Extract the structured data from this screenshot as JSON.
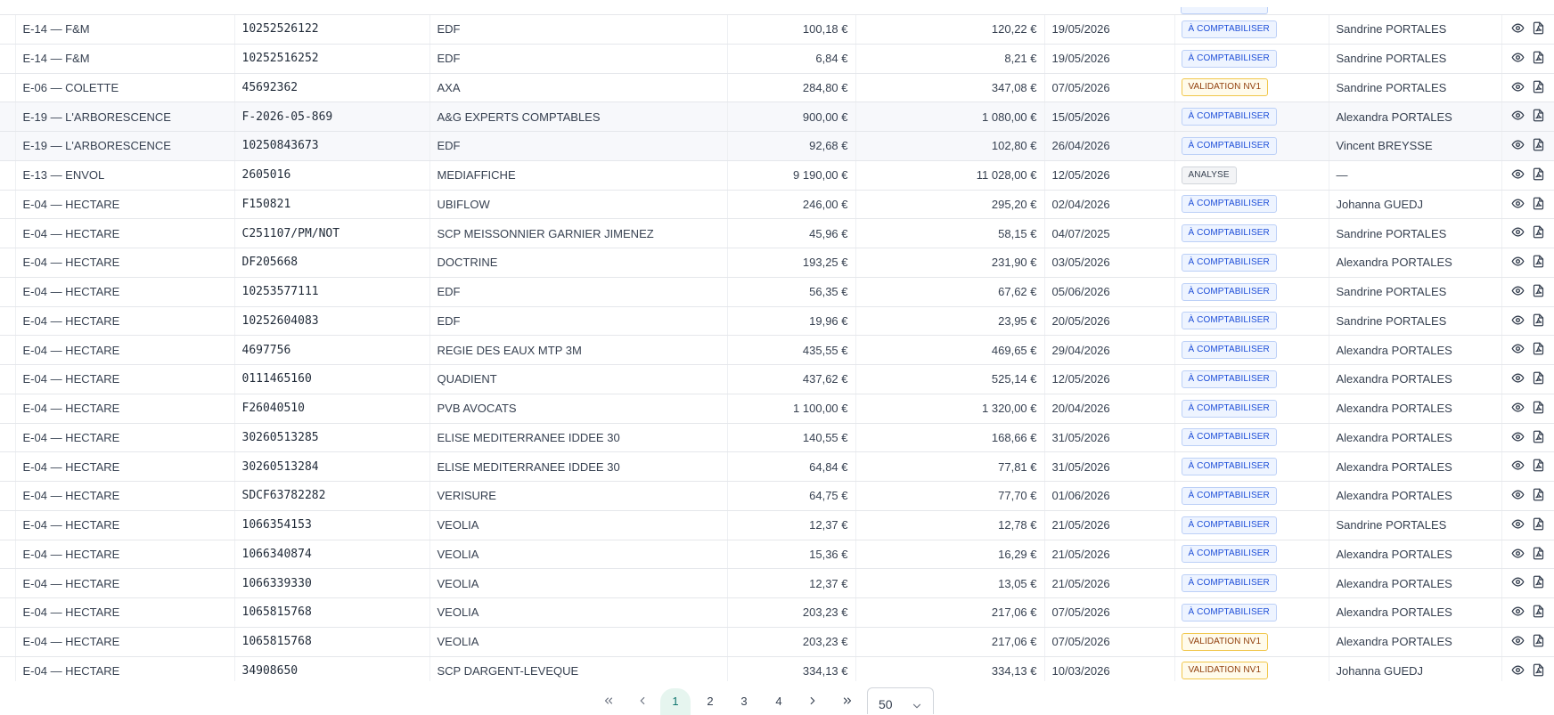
{
  "rows": [
    {
      "client": "E-14 — F&M",
      "ref": "10252526122",
      "supplier": "EDF",
      "ht": "100,18 €",
      "ttc": "120,22 €",
      "date": "19/05/2026",
      "status": "À COMPTABILISER",
      "status_type": "comptabiliser",
      "assignee": "Sandrine PORTALES"
    },
    {
      "client": "E-14 — F&M",
      "ref": "10252516252",
      "supplier": "EDF",
      "ht": "6,84 €",
      "ttc": "8,21 €",
      "date": "19/05/2026",
      "status": "À COMPTABILISER",
      "status_type": "comptabiliser",
      "assignee": "Sandrine PORTALES"
    },
    {
      "client": "E-06 — COLETTE",
      "ref": "45692362",
      "supplier": "AXA",
      "ht": "284,80 €",
      "ttc": "347,08 €",
      "date": "07/05/2026",
      "status": "VALIDATION NV1",
      "status_type": "validation",
      "assignee": "Sandrine PORTALES"
    },
    {
      "client": "E-19 — L'ARBORESCENCE",
      "ref": "F-2026-05-869",
      "supplier": "A&G EXPERTS COMPTABLES",
      "ht": "900,00 €",
      "ttc": "1 080,00 €",
      "date": "15/05/2026",
      "status": "À COMPTABILISER",
      "status_type": "comptabiliser",
      "assignee": "Alexandra PORTALES",
      "alt": true
    },
    {
      "client": "E-19 — L'ARBORESCENCE",
      "ref": "10250843673",
      "supplier": "EDF",
      "ht": "92,68 €",
      "ttc": "102,80 €",
      "date": "26/04/2026",
      "status": "À COMPTABILISER",
      "status_type": "comptabiliser",
      "assignee": "Vincent BREYSSE",
      "alt": true
    },
    {
      "client": "E-13 — ENVOL",
      "ref": "2605016",
      "supplier": "MEDIAFFICHE",
      "ht": "9 190,00 €",
      "ttc": "11 028,00 €",
      "date": "12/05/2026",
      "status": "ANALYSE",
      "status_type": "analyse",
      "assignee": "—"
    },
    {
      "client": "E-04 — HECTARE",
      "ref": "F150821",
      "supplier": "UBIFLOW",
      "ht": "246,00 €",
      "ttc": "295,20 €",
      "date": "02/04/2026",
      "status": "À COMPTABILISER",
      "status_type": "comptabiliser",
      "assignee": "Johanna GUEDJ"
    },
    {
      "client": "E-04 — HECTARE",
      "ref": "C251107/PM/NOT",
      "supplier": "SCP MEISSONNIER GARNIER JIMENEZ",
      "ht": "45,96 €",
      "ttc": "58,15 €",
      "date": "04/07/2025",
      "status": "À COMPTABILISER",
      "status_type": "comptabiliser",
      "assignee": "Sandrine PORTALES"
    },
    {
      "client": "E-04 — HECTARE",
      "ref": "DF205668",
      "supplier": "DOCTRINE",
      "ht": "193,25 €",
      "ttc": "231,90 €",
      "date": "03/05/2026",
      "status": "À COMPTABILISER",
      "status_type": "comptabiliser",
      "assignee": "Alexandra PORTALES"
    },
    {
      "client": "E-04 — HECTARE",
      "ref": "10253577111",
      "supplier": "EDF",
      "ht": "56,35 €",
      "ttc": "67,62 €",
      "date": "05/06/2026",
      "status": "À COMPTABILISER",
      "status_type": "comptabiliser",
      "assignee": "Sandrine PORTALES"
    },
    {
      "client": "E-04 — HECTARE",
      "ref": "10252604083",
      "supplier": "EDF",
      "ht": "19,96 €",
      "ttc": "23,95 €",
      "date": "20/05/2026",
      "status": "À COMPTABILISER",
      "status_type": "comptabiliser",
      "assignee": "Sandrine PORTALES"
    },
    {
      "client": "E-04 — HECTARE",
      "ref": "4697756",
      "supplier": "REGIE DES EAUX MTP 3M",
      "ht": "435,55 €",
      "ttc": "469,65 €",
      "date": "29/04/2026",
      "status": "À COMPTABILISER",
      "status_type": "comptabiliser",
      "assignee": "Alexandra PORTALES"
    },
    {
      "client": "E-04 — HECTARE",
      "ref": "0111465160",
      "supplier": "QUADIENT",
      "ht": "437,62 €",
      "ttc": "525,14 €",
      "date": "12/05/2026",
      "status": "À COMPTABILISER",
      "status_type": "comptabiliser",
      "assignee": "Alexandra PORTALES"
    },
    {
      "client": "E-04 — HECTARE",
      "ref": "F26040510",
      "supplier": "PVB AVOCATS",
      "ht": "1 100,00 €",
      "ttc": "1 320,00 €",
      "date": "20/04/2026",
      "status": "À COMPTABILISER",
      "status_type": "comptabiliser",
      "assignee": "Alexandra PORTALES"
    },
    {
      "client": "E-04 — HECTARE",
      "ref": "30260513285",
      "supplier": "ELISE MEDITERRANEE IDDEE 30",
      "ht": "140,55 €",
      "ttc": "168,66 €",
      "date": "31/05/2026",
      "status": "À COMPTABILISER",
      "status_type": "comptabiliser",
      "assignee": "Alexandra PORTALES"
    },
    {
      "client": "E-04 — HECTARE",
      "ref": "30260513284",
      "supplier": "ELISE MEDITERRANEE IDDEE 30",
      "ht": "64,84 €",
      "ttc": "77,81 €",
      "date": "31/05/2026",
      "status": "À COMPTABILISER",
      "status_type": "comptabiliser",
      "assignee": "Alexandra PORTALES"
    },
    {
      "client": "E-04 — HECTARE",
      "ref": "SDCF63782282",
      "supplier": "VERISURE",
      "ht": "64,75 €",
      "ttc": "77,70 €",
      "date": "01/06/2026",
      "status": "À COMPTABILISER",
      "status_type": "comptabiliser",
      "assignee": "Alexandra PORTALES"
    },
    {
      "client": "E-04 — HECTARE",
      "ref": "1066354153",
      "supplier": "VEOLIA",
      "ht": "12,37 €",
      "ttc": "12,78 €",
      "date": "21/05/2026",
      "status": "À COMPTABILISER",
      "status_type": "comptabiliser",
      "assignee": "Sandrine PORTALES"
    },
    {
      "client": "E-04 — HECTARE",
      "ref": "1066340874",
      "supplier": "VEOLIA",
      "ht": "15,36 €",
      "ttc": "16,29 €",
      "date": "21/05/2026",
      "status": "À COMPTABILISER",
      "status_type": "comptabiliser",
      "assignee": "Alexandra PORTALES"
    },
    {
      "client": "E-04 — HECTARE",
      "ref": "1066339330",
      "supplier": "VEOLIA",
      "ht": "12,37 €",
      "ttc": "13,05 €",
      "date": "21/05/2026",
      "status": "À COMPTABILISER",
      "status_type": "comptabiliser",
      "assignee": "Alexandra PORTALES"
    },
    {
      "client": "E-04 — HECTARE",
      "ref": "1065815768",
      "supplier": "VEOLIA",
      "ht": "203,23 €",
      "ttc": "217,06 €",
      "date": "07/05/2026",
      "status": "À COMPTABILISER",
      "status_type": "comptabiliser",
      "assignee": "Alexandra PORTALES"
    },
    {
      "client": "E-04 — HECTARE",
      "ref": "1065815768",
      "supplier": "VEOLIA",
      "ht": "203,23 €",
      "ttc": "217,06 €",
      "date": "07/05/2026",
      "status": "VALIDATION NV1",
      "status_type": "validation",
      "assignee": "Alexandra PORTALES"
    },
    {
      "client": "E-04 — HECTARE",
      "ref": "34908650",
      "supplier": "SCP DARGENT-LEVEQUE",
      "ht": "334,13 €",
      "ttc": "334,13 €",
      "date": "10/03/2026",
      "status": "VALIDATION NV1",
      "status_type": "validation",
      "assignee": "Johanna GUEDJ"
    }
  ],
  "row_actions": {
    "view_icon": "eye-icon",
    "pdf_icon": "pdf-file-icon"
  },
  "pagination": {
    "first_icon": "double-chevron-left-icon",
    "prev_icon": "chevron-left-icon",
    "pages": [
      "1",
      "2",
      "3",
      "4"
    ],
    "current_page": "1",
    "next_icon": "chevron-right-icon",
    "last_icon": "double-chevron-right-icon",
    "page_size": "50",
    "page_size_icon": "chevron-down-icon"
  },
  "colors": {
    "comptabiliser_text": "#1d4ed8",
    "validation_text": "#92400e",
    "analyse_text": "#374151",
    "active_page_bg": "#e6f5ef",
    "active_page_text": "#0f766e"
  }
}
